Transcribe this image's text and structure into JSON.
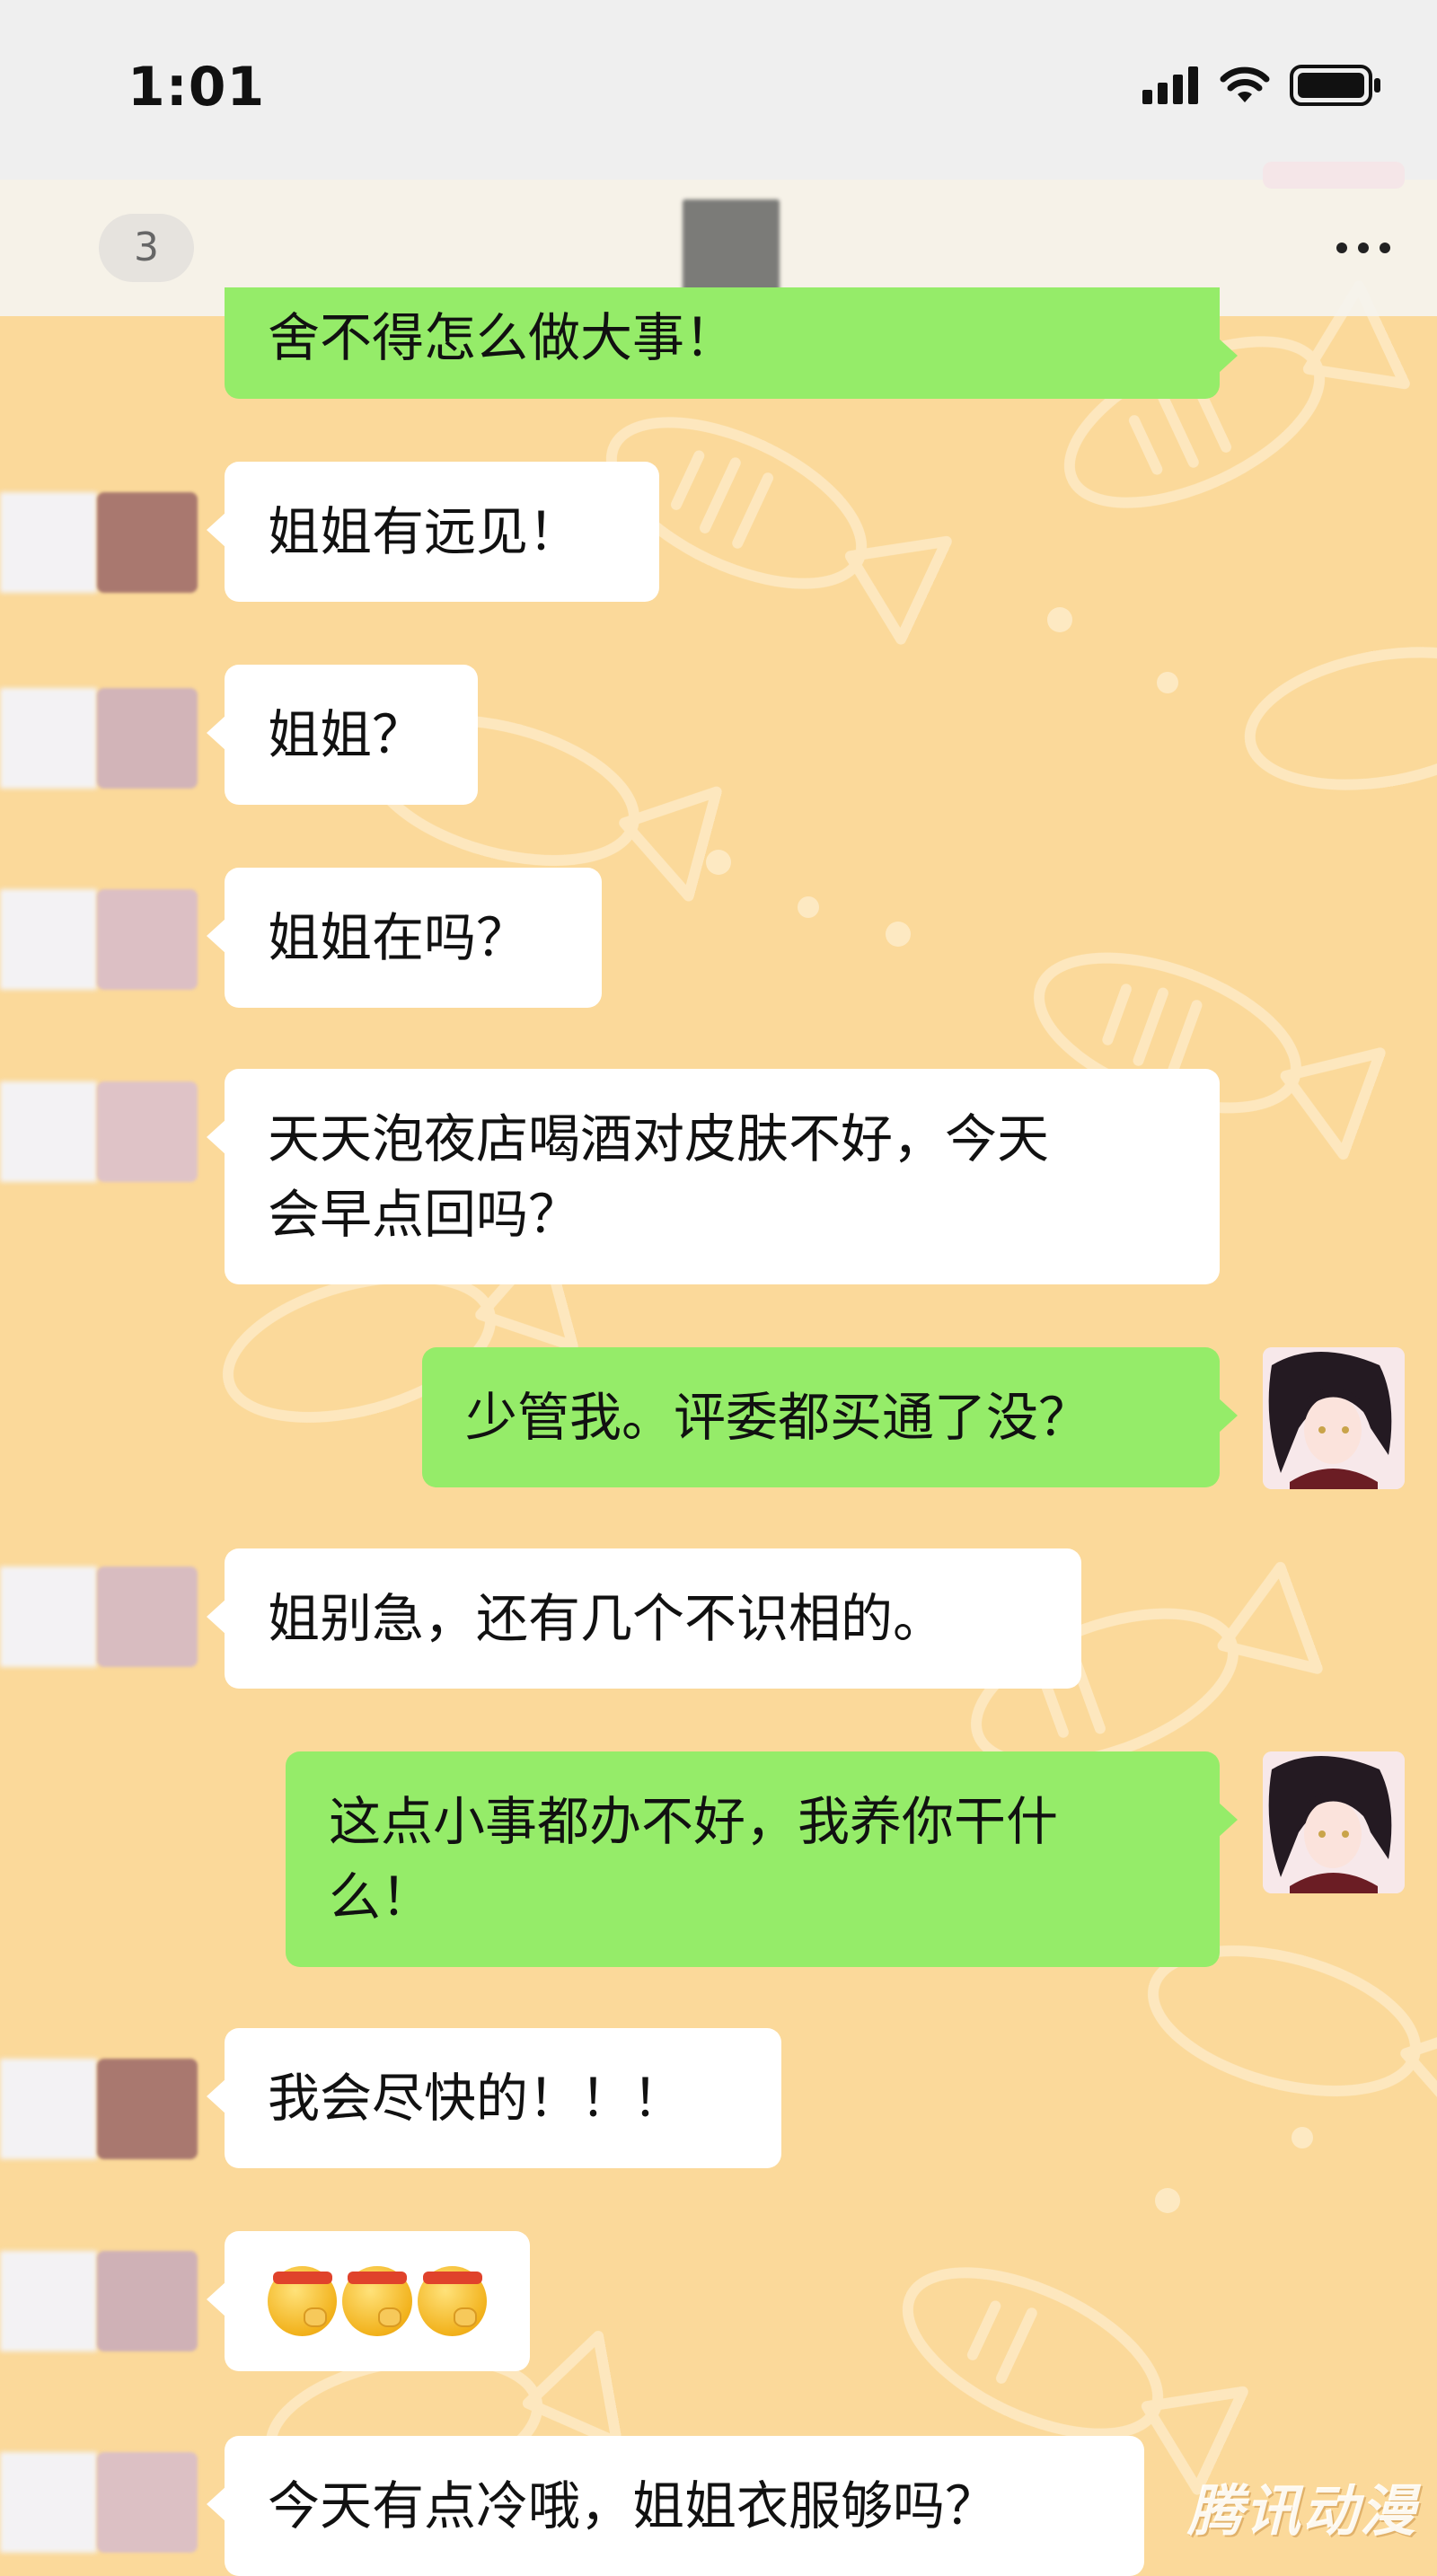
{
  "status_bar": {
    "time": "1:01"
  },
  "nav_bar": {
    "unread_count": "3"
  },
  "messages": [
    {
      "side": "out",
      "text": "舍不得怎么做大事！"
    },
    {
      "side": "in",
      "text": "姐姐有远见！"
    },
    {
      "side": "in",
      "text": "姐姐？"
    },
    {
      "side": "in",
      "text": "姐姐在吗？"
    },
    {
      "side": "in",
      "line1": "天天泡夜店喝酒对皮肤不好，今天",
      "line2": "会早点回吗？"
    },
    {
      "side": "out",
      "text": "少管我。评委都买通了没？"
    },
    {
      "side": "in",
      "text": "姐别急，还有几个不识相的。"
    },
    {
      "side": "out",
      "line1": "这点小事都办不好，我养你干什",
      "line2": "么！"
    },
    {
      "side": "in",
      "text": "我会尽快的！！！"
    },
    {
      "side": "in",
      "emoji_count": 3,
      "emoji": "shushing-face-with-headband"
    },
    {
      "side": "in",
      "text": "今天有点冷哦，姐姐衣服够吗？"
    }
  ],
  "watermark": "腾讯动漫",
  "colors": {
    "background": "#fbd99a",
    "incoming_bubble": "#ffffff",
    "outgoing_bubble": "#95ec69"
  }
}
